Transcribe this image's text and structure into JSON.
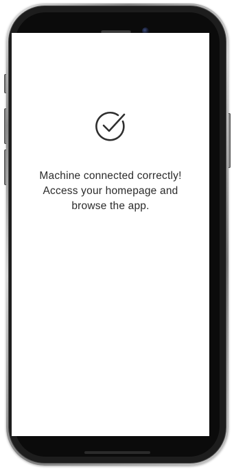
{
  "screen": {
    "status_icon": "check-circle-icon",
    "message": "Machine connected correctly! Access your homepage and browse the app."
  },
  "colors": {
    "text": "#2a2a2a",
    "icon_stroke": "#2f2f2f",
    "screen_background": "#ffffff",
    "phone_bezel": "#0b0b0b"
  }
}
